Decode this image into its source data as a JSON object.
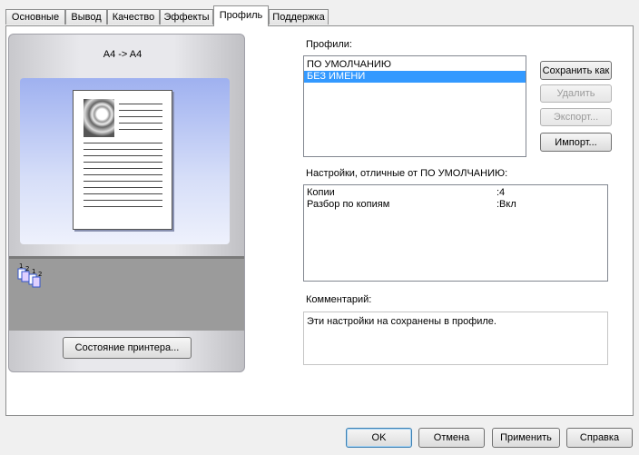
{
  "tabs": [
    {
      "label": "Основные"
    },
    {
      "label": "Вывод"
    },
    {
      "label": "Качество"
    },
    {
      "label": "Эффекты"
    },
    {
      "label": "Профиль"
    },
    {
      "label": "Поддержка"
    }
  ],
  "preview": {
    "paper_size": "A4 -> A4",
    "printer_status_button": "Состояние принтера..."
  },
  "profiles": {
    "label": "Профили:",
    "items": [
      {
        "label": "ПО УМОЛЧАНИЮ"
      },
      {
        "label": "БЕЗ ИМЕНИ"
      }
    ],
    "save_as": "Сохранить как",
    "delete": "Удалить",
    "export": "Экспорт...",
    "import": "Импорт..."
  },
  "diff": {
    "label": "Настройки, отличные от ПО УМОЛЧАНИЮ:",
    "rows": [
      {
        "key": "Копии",
        "value": ":4"
      },
      {
        "key": "Разбор по копиям",
        "value": ":Вкл"
      }
    ]
  },
  "comment": {
    "label": "Комментарий:",
    "text": "Эти настройки на сохранены в профиле."
  },
  "footer": {
    "ok": "OK",
    "cancel": "Отмена",
    "apply": "Применить",
    "help": "Справка"
  },
  "colors": {
    "selection": "#3399ff",
    "default_button_border": "#3c7fb1"
  }
}
